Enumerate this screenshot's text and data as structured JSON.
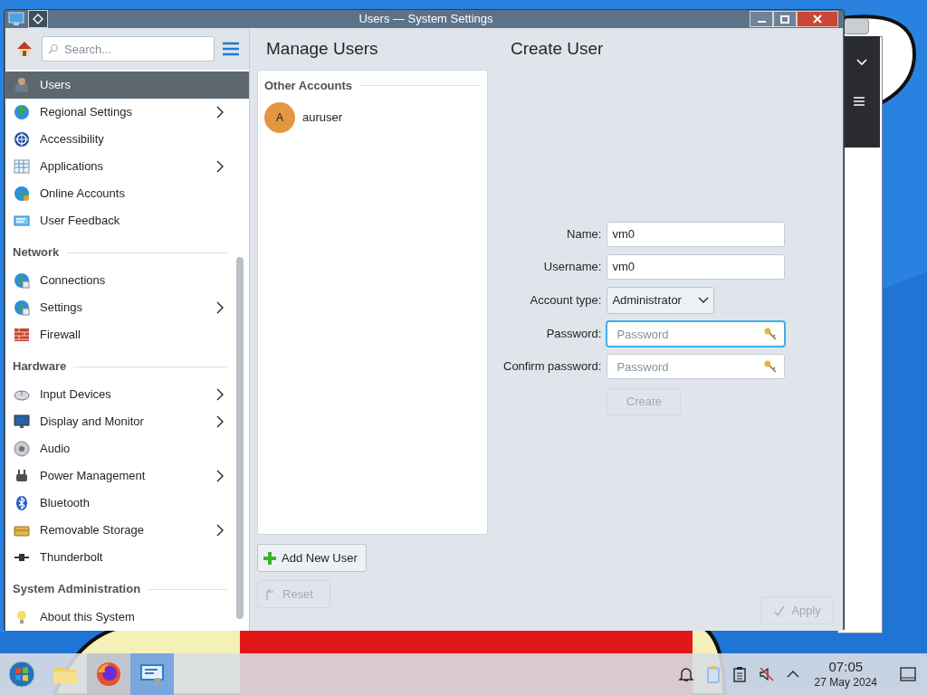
{
  "window": {
    "title": "Users — System Settings"
  },
  "sidebar": {
    "search_placeholder": "Search...",
    "sections": [
      {
        "items": [
          {
            "label": "Users",
            "selected": true,
            "submenu": false
          },
          {
            "label": "Regional Settings",
            "selected": false,
            "submenu": true
          },
          {
            "label": "Accessibility",
            "selected": false,
            "submenu": false
          },
          {
            "label": "Applications",
            "selected": false,
            "submenu": true
          },
          {
            "label": "Online Accounts",
            "selected": false,
            "submenu": false
          },
          {
            "label": "User Feedback",
            "selected": false,
            "submenu": false
          }
        ]
      },
      {
        "header": "Network",
        "items": [
          {
            "label": "Connections",
            "selected": false,
            "submenu": false
          },
          {
            "label": "Settings",
            "selected": false,
            "submenu": true
          },
          {
            "label": "Firewall",
            "selected": false,
            "submenu": false
          }
        ]
      },
      {
        "header": "Hardware",
        "items": [
          {
            "label": "Input Devices",
            "selected": false,
            "submenu": true
          },
          {
            "label": "Display and Monitor",
            "selected": false,
            "submenu": true
          },
          {
            "label": "Audio",
            "selected": false,
            "submenu": false
          },
          {
            "label": "Power Management",
            "selected": false,
            "submenu": true
          },
          {
            "label": "Bluetooth",
            "selected": false,
            "submenu": false
          },
          {
            "label": "Removable Storage",
            "selected": false,
            "submenu": true
          },
          {
            "label": "Thunderbolt",
            "selected": false,
            "submenu": false
          }
        ]
      },
      {
        "header": "System Administration",
        "items": [
          {
            "label": "About this System",
            "selected": false,
            "submenu": false
          }
        ]
      }
    ]
  },
  "manage_users": {
    "title": "Manage Users",
    "group": "Other Accounts",
    "accounts": [
      {
        "initial": "A",
        "name": "auruser"
      }
    ],
    "add_button": "Add New User"
  },
  "create_user": {
    "title": "Create User",
    "fields": [
      {
        "kind": "text",
        "label": "Name:",
        "value": "vm0",
        "focused": false
      },
      {
        "kind": "text",
        "label": "Username:",
        "value": "vm0",
        "focused": false
      },
      {
        "kind": "select",
        "label": "Account type:",
        "value": "Administrator",
        "focused": false
      },
      {
        "kind": "password",
        "label": "Password:",
        "placeholder": "Password",
        "focused": true
      },
      {
        "kind": "password",
        "label": "Confirm password:",
        "placeholder": "Password",
        "focused": false
      }
    ],
    "create_button": {
      "label": "Create",
      "disabled": true
    }
  },
  "footer": {
    "reset": {
      "label": "Reset",
      "disabled": true
    },
    "apply": {
      "label": "Apply",
      "disabled": true
    }
  },
  "taskbar": {
    "apps": [
      {
        "kind": "start",
        "hovered": false,
        "selected": false
      },
      {
        "kind": "files",
        "hovered": false,
        "selected": false
      },
      {
        "kind": "browser",
        "hovered": true,
        "selected": false
      },
      {
        "kind": "settings",
        "hovered": false,
        "selected": true
      }
    ],
    "clock": {
      "time": "07:05",
      "date": "27 May 2024"
    }
  }
}
